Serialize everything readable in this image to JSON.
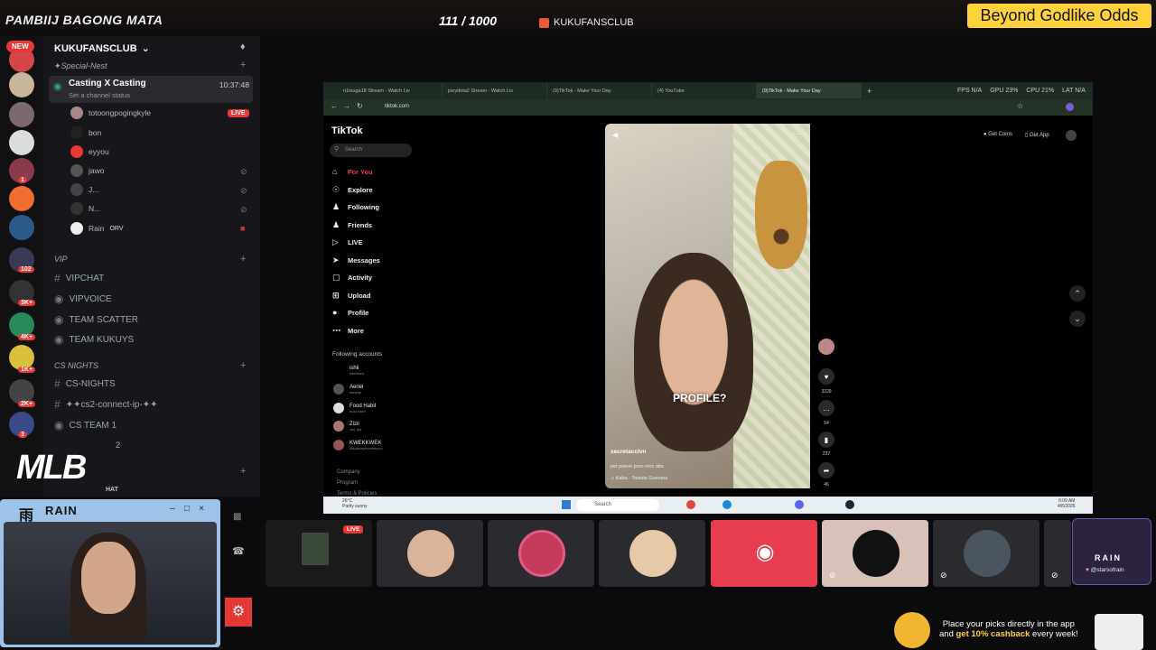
{
  "overlay": {
    "stream_title": "PAMBIIJ BAGONG MATA",
    "sub_goal": "111 / 1000",
    "server_label": "KUKUFANSCLUB",
    "promo_text": "Beyond Godlike Odds",
    "new_badge": "NEW",
    "mlb_logo": "MLB"
  },
  "rail": {
    "badges": [
      "1",
      "102",
      "3K+",
      "4K+",
      "1K+",
      "2K+",
      "3"
    ]
  },
  "discord": {
    "server_name": "KUKUFANSCLUB",
    "cat_special": "✦Special-Nest",
    "active_channel": {
      "name": "Casting X Casting",
      "status": "Set a channel status",
      "time": "10:37:48"
    },
    "users": [
      {
        "name": "totoongpogingkyle",
        "live": "LIVE"
      },
      {
        "name": "bon"
      },
      {
        "name": "eyyou"
      },
      {
        "name": "jawo"
      },
      {
        "name": "J..."
      },
      {
        "name": "N..."
      },
      {
        "name": "Rain",
        "tag": "ORV"
      }
    ],
    "cat_vip": "VIP",
    "vip_channels": [
      "VIPCHAT",
      "VIPVOICE",
      "TEAM SCATTER",
      "TEAM KUKUYS"
    ],
    "cat_cs": "CS NIGHTS",
    "cs_channels": [
      "CS-NIGHTS",
      "✦✦cs2-connect-ip-✦✦",
      "CS TEAM 1",
      "2"
    ],
    "partial_hat": "HAT"
  },
  "browser": {
    "tabs": [
      "n1tsuga18 Stream - Watch Liv",
      "joeydota2 Stream - Watch Liv",
      "(9)TikTok - Make Your Day",
      "(4) YouTube",
      "(9)TikTok - Make Your Day"
    ],
    "perf": {
      "fps": "FPS N/A",
      "gpu": "GPU 23%",
      "cpu": "CPU 21%",
      "lat": "LAT N/A"
    },
    "url": "tiktok.com"
  },
  "tiktok": {
    "logo": "TikTok",
    "search_placeholder": "Search",
    "nav": [
      "For You",
      "Explore",
      "Following",
      "Friends",
      "LIVE",
      "Messages",
      "Activity",
      "Upload",
      "Profile",
      "More"
    ],
    "following_header": "Following accounts",
    "accounts": [
      {
        "name": "ishii",
        "handle": "ishiintaro"
      },
      {
        "name": "Aeriel",
        "handle": "aeriellp"
      },
      {
        "name": "Food Habit",
        "handle": "food.habit"
      },
      {
        "name": "Zizii",
        "handle": "zizi_fps"
      },
      {
        "name": "KWEKKWEK",
        "handle": "stayawayfrommeyou"
      }
    ],
    "footer": [
      "Company",
      "Program",
      "Terms & Policies"
    ],
    "get_coins": "Get Coins",
    "get_app": "Get App",
    "video": {
      "caption": "PROFILE?",
      "username": "secretacclvn",
      "description": "pet peeve pero nice abs",
      "music": "Kaba - Tootsie Guevara"
    },
    "counts": {
      "likes": "3229",
      "comments": "54",
      "saves": "237",
      "shares": "46"
    }
  },
  "taskbar": {
    "weather_temp": "26°C",
    "weather_desc": "Partly sunny",
    "search": "Search",
    "time": "6:09 AM",
    "date": "4/8/2026"
  },
  "stage": {
    "live_label": "LIVE"
  },
  "cam": {
    "title": "RAIN",
    "mark": "雨"
  },
  "brand": {
    "rain_logo": "RAIN",
    "handle": "@starsofrain"
  },
  "ad": {
    "line1": "Place your picks directly in the app",
    "line2_pre": "and ",
    "line2_bold": "get 10% cashback",
    "line2_post": " every week!"
  }
}
